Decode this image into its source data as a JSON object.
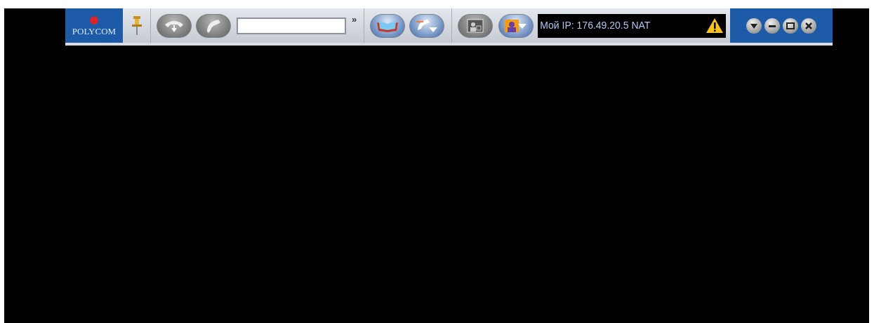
{
  "logo": {
    "text": "POLYCOM"
  },
  "more": {
    "text": "»"
  },
  "status": {
    "text": "Мой IP: 176.49.20.5 NAT"
  }
}
